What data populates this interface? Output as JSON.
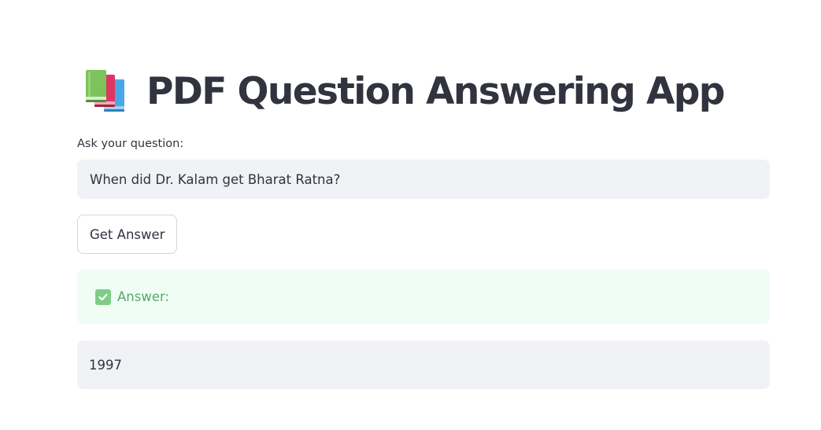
{
  "header": {
    "icon": "books-icon",
    "title": "PDF Question Answering App"
  },
  "question": {
    "label": "Ask your question:",
    "value": "When did Dr. Kalam get Bharat Ratna?"
  },
  "actions": {
    "get_answer_label": "Get Answer"
  },
  "result": {
    "status_icon": "check-mark-icon",
    "status_label": "Answer:",
    "answer": "1997"
  },
  "colors": {
    "text": "#31333f",
    "input_bg": "#f0f2f6",
    "success_bg": "#f0fdf4",
    "success_text": "#5aa86a",
    "check_green": "#7dce85"
  }
}
